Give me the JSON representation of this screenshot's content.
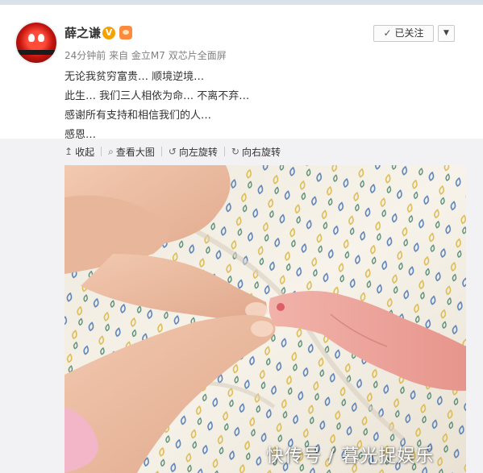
{
  "post": {
    "author": "薛之谦",
    "verified_badge": "V",
    "meta": "24分钟前 来自 金立M7 双芯片全面屏",
    "lines": [
      "无论我贫穷富贵… 顺境逆境…",
      "此生… 我们三人相依为命… 不离不弃…",
      "感谢所有支持和相信我们的人…",
      "感恩…"
    ]
  },
  "follow": {
    "label": "已关注",
    "check_icon": "✓",
    "more_icon": "▼"
  },
  "toolbar": {
    "collapse": "收起",
    "view_large": "查看大图",
    "rotate_left": "向左旋转",
    "rotate_right": "向右旋转",
    "icons": {
      "collapse": "↥",
      "view_large": "⌕",
      "rotate_left": "↺",
      "rotate_right": "↻"
    }
  },
  "watermark": "快传号 / 暮光捉娱乐",
  "colors": {
    "topbar": "#d9e2ea",
    "expanded_bg": "#f2f2f5",
    "verified": "#f5a100"
  }
}
